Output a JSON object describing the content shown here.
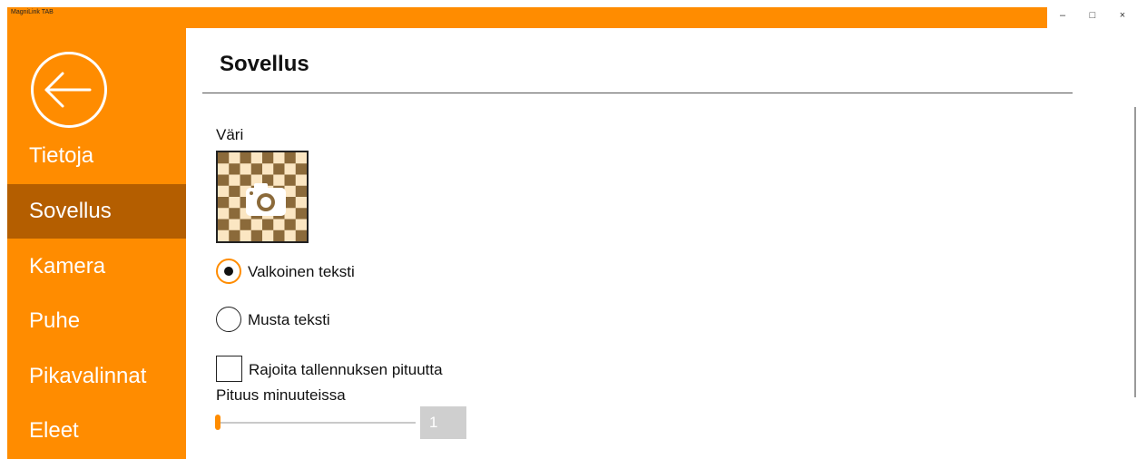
{
  "window": {
    "title": "MagniLink TAB",
    "controls": {
      "minimize": "–",
      "maximize": "□",
      "close": "×"
    }
  },
  "sidebar": {
    "back_icon": "back-arrow-icon",
    "items": [
      {
        "label": "Tietoja",
        "active": false
      },
      {
        "label": "Sovellus",
        "active": true
      },
      {
        "label": "Kamera",
        "active": false
      },
      {
        "label": "Puhe",
        "active": false
      },
      {
        "label": "Pikavalinnat",
        "active": false
      },
      {
        "label": "Eleet",
        "active": false
      }
    ]
  },
  "main": {
    "title": "Sovellus",
    "color_section": {
      "label": "Väri",
      "preview_icon": "camera-icon",
      "options": [
        {
          "label": "Valkoinen teksti",
          "selected": true
        },
        {
          "label": "Musta teksti",
          "selected": false
        }
      ]
    },
    "limit_recording": {
      "label": "Rajoita tallennuksen pituutta",
      "checked": false
    },
    "duration": {
      "label": "Pituus minuuteissa",
      "value": "1",
      "slider_fraction": 0
    }
  },
  "colors": {
    "accent": "#ff8c00",
    "sidebar_active": "#b45e00",
    "checker_dark": "#8b6a3a",
    "checker_light": "#fbe6c2"
  }
}
